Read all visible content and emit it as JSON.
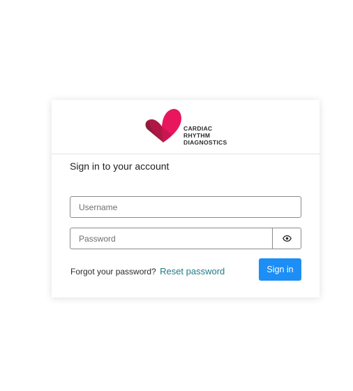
{
  "brand": {
    "logo_lines": [
      "CARDIAC",
      "RHYTHM",
      "DIAGNOSTICS"
    ],
    "colors": {
      "heart_primary": "#e8175d",
      "heart_dark": "#8e1c3c",
      "heart_mid": "#c91552"
    }
  },
  "form": {
    "title": "Sign in to your account",
    "username_placeholder": "Username",
    "password_placeholder": "Password",
    "toggle_icon": "eye-icon",
    "forgot_text": "Forgot your password?",
    "reset_link": "Reset password",
    "submit_label": "Sign in"
  },
  "colors": {
    "accent": "#1c8ef5",
    "link": "#1f7a86"
  }
}
